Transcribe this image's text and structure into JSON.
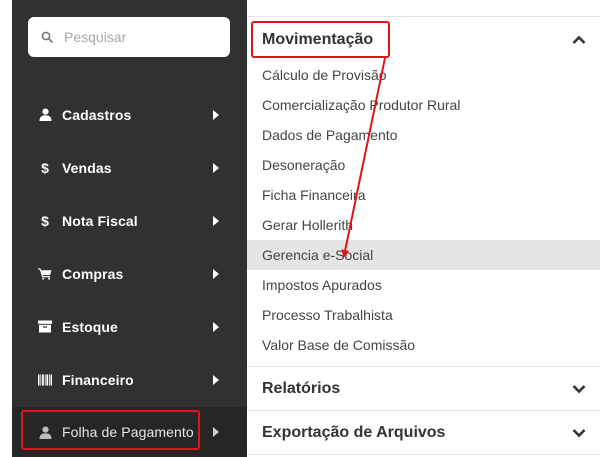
{
  "search": {
    "placeholder": "Pesquisar"
  },
  "sidebar": {
    "items": [
      {
        "label": "Cadastros",
        "icon": "user-icon"
      },
      {
        "label": "Vendas",
        "icon": "dollar-icon"
      },
      {
        "label": "Nota Fiscal",
        "icon": "dollar-icon"
      },
      {
        "label": "Compras",
        "icon": "cart-icon"
      },
      {
        "label": "Estoque",
        "icon": "archive-icon"
      },
      {
        "label": "Financeiro",
        "icon": "barcode-icon"
      },
      {
        "label": "Folha de Pagamento",
        "icon": "user-icon",
        "active": true
      }
    ]
  },
  "panel": {
    "sections": [
      {
        "title": "Movimentação",
        "expanded": true,
        "items": [
          "Cálculo de Provisão",
          "Comercialização Produtor Rural",
          "Dados de Pagamento",
          "Desoneração",
          "Ficha Financeira",
          "Gerar Hollerith",
          "Gerencia e-Social",
          "Impostos Apurados",
          "Processo Trabalhista",
          "Valor Base de Comissão"
        ],
        "highlighted_item": "Gerencia e-Social"
      },
      {
        "title": "Relatórios",
        "expanded": false
      },
      {
        "title": "Exportação de Arquivos",
        "expanded": false
      }
    ]
  },
  "colors": {
    "sidebar_bg": "#313131",
    "sidebar_active_bg": "#262626",
    "annotation_red": "#e0141b",
    "hover_bg": "#e5e5e5"
  }
}
